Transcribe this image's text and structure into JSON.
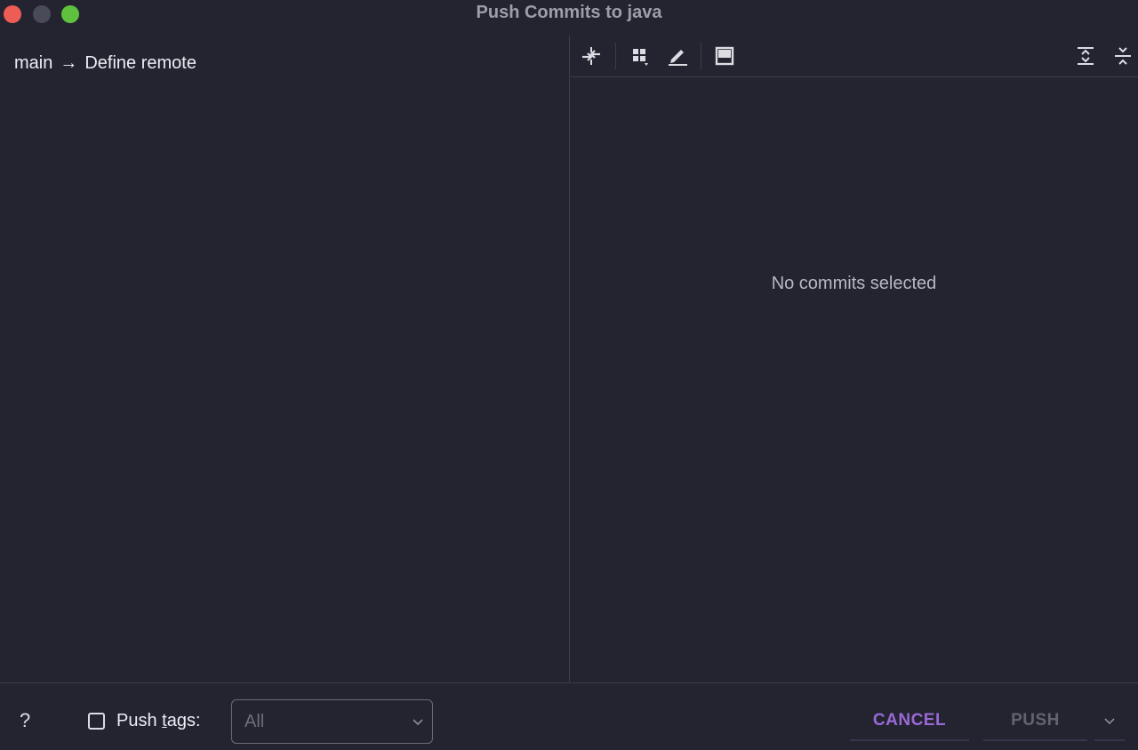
{
  "window": {
    "title": "Push Commits to java"
  },
  "left_panel": {
    "branch": "main",
    "arrow": "→",
    "target": "Define remote"
  },
  "right_panel": {
    "toolbar": {
      "items": [
        {
          "icon": "collapse-arrows-icon"
        },
        {
          "icon": "group-by-icon"
        },
        {
          "icon": "edit-icon"
        },
        {
          "icon": "preview-diff-icon"
        },
        {
          "icon": "expand-all-icon"
        },
        {
          "icon": "collapse-all-icon"
        }
      ]
    },
    "empty_message": "No commits selected"
  },
  "bottom_bar": {
    "help_label": "?",
    "push_tags_checked": false,
    "push_tags_label_prefix": "Push ",
    "push_tags_label_mnemonic": "t",
    "push_tags_label_suffix": "ags:",
    "tags_select_value": "All",
    "cancel_label": "CANCEL",
    "push_label": "PUSH"
  },
  "colors": {
    "background": "#232430",
    "accent": "#9a69d6",
    "close": "#ee5c56",
    "zoom": "#5fc23f"
  }
}
